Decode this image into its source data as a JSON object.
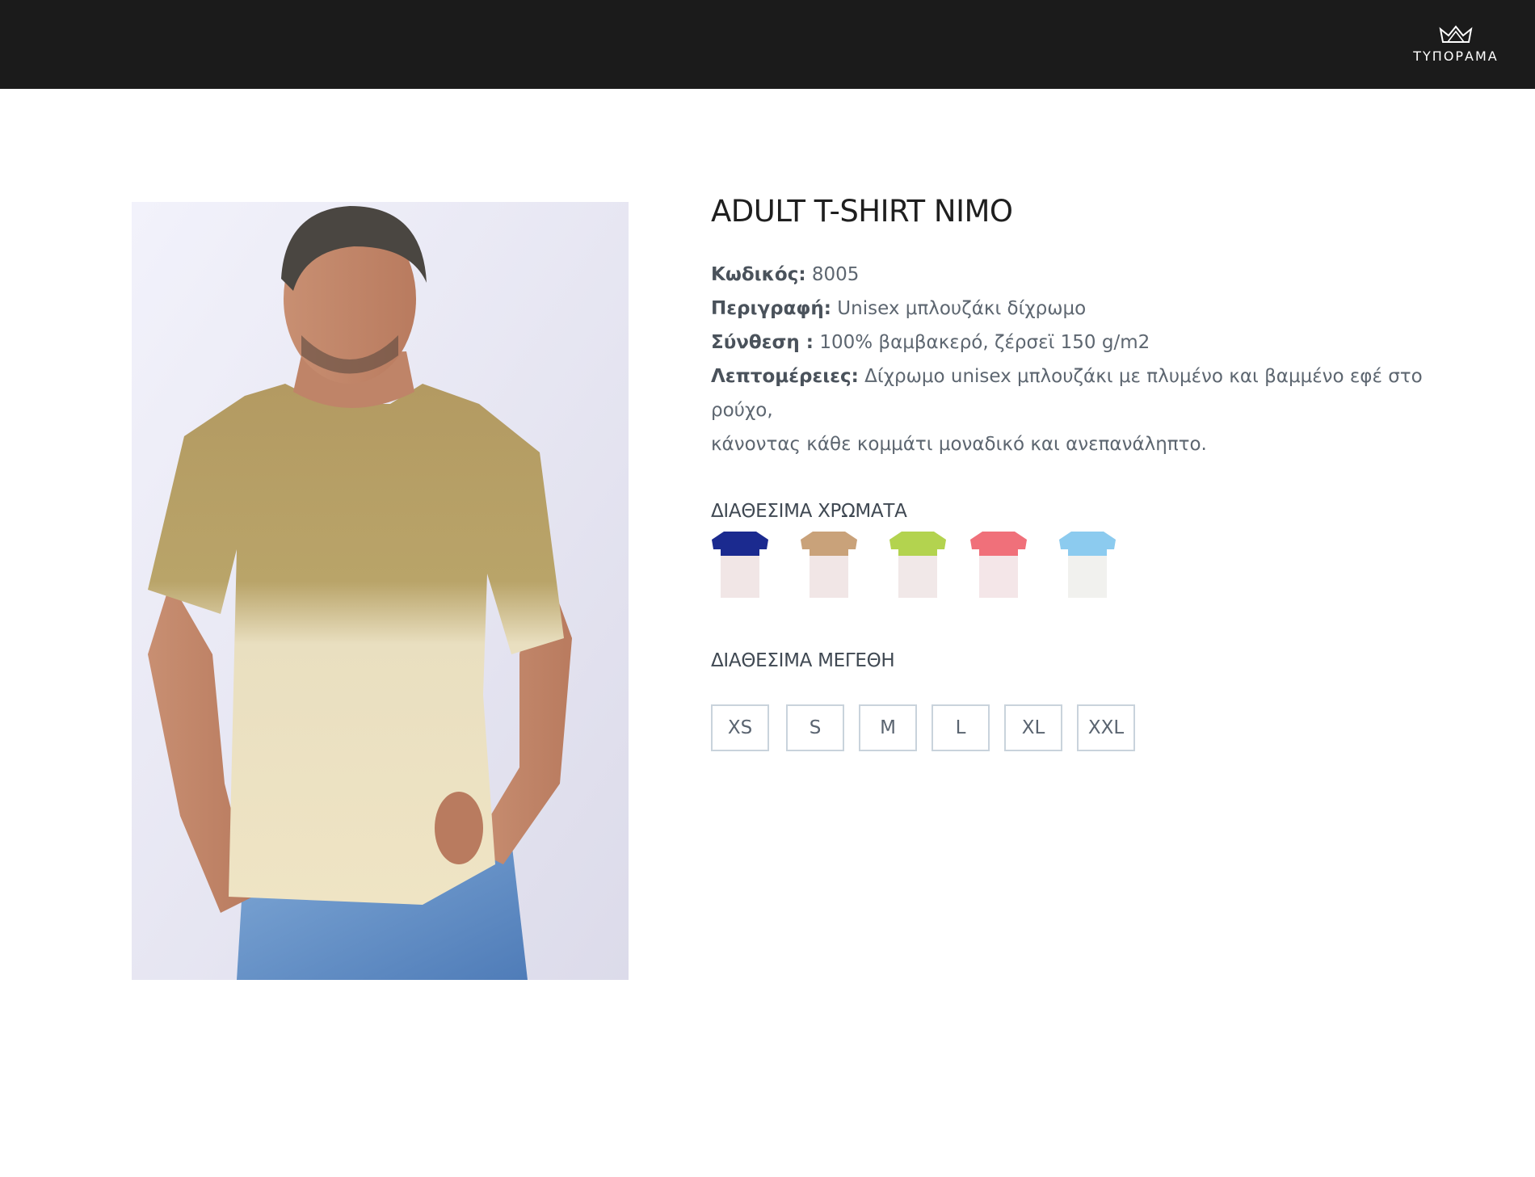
{
  "header": {
    "brand": "ΤΥΠΟΡΑΜΑ"
  },
  "product": {
    "title": "ADULT T-SHIRT NIMO",
    "specs": [
      {
        "label": "Κωδικός:",
        "value": " 8005"
      },
      {
        "label": "Περιγραφή:",
        "value": " Unisex μπλουζάκι δίχρωμο"
      },
      {
        "label": "Σύνθεση :",
        "value": " 100% βαμβακερό, ζέρσεϊ 150 g/m2"
      },
      {
        "label": "Λεπτομέρειες:",
        "value": " Δίχρωμο unisex μπλουζάκι με πλυμένο και βαμμένο εφέ στο ρούχο,"
      }
    ],
    "details_continuation": "κάνοντας κάθε κομμάτι μοναδικό και ανεπανάληπτο."
  },
  "colors": {
    "title": "ΔΙΑΘΕΣΙΜΑ ΧΡΩΜΑΤΑ",
    "swatches": [
      {
        "top": "#1b2a8f",
        "bottom": "#f1e6e6"
      },
      {
        "top": "#c9a27a",
        "bottom": "#f1e6e6"
      },
      {
        "top": "#b3d34f",
        "bottom": "#f1e8e8"
      },
      {
        "top": "#f0707a",
        "bottom": "#f4e6e8"
      },
      {
        "top": "#8ccbef",
        "bottom": "#f1f1ee"
      }
    ]
  },
  "sizes": {
    "title": "ΔΙΑΘΕΣΙΜΑ ΜΕΓΕΘΗ",
    "options": [
      "XS",
      "S",
      "M",
      "L",
      "XL",
      "XXL"
    ]
  }
}
